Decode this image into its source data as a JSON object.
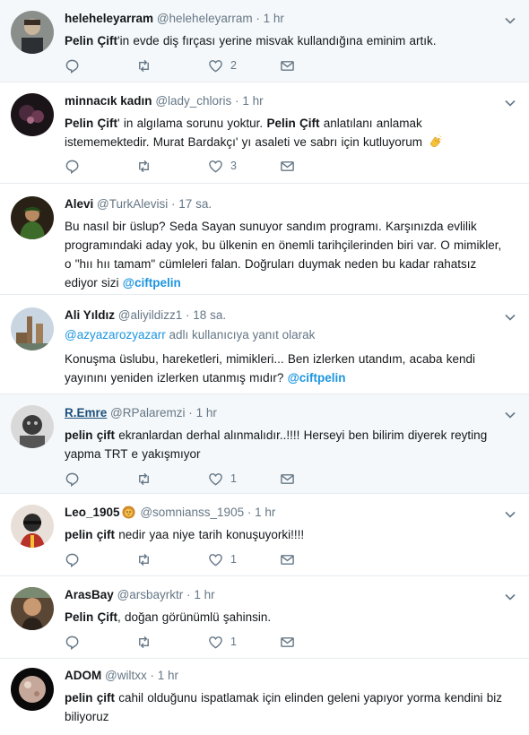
{
  "tweets": [
    {
      "name": "heleheleyarram",
      "handle": "@heleheleyarram",
      "time": "1 hr",
      "text_parts": [
        {
          "t": "Pelin Çift",
          "b": true
        },
        {
          "t": "'in evde diş fırçası yerine misvak kullandığına eminim artık."
        }
      ],
      "likes": "2"
    },
    {
      "name": "minnacık kadın",
      "handle": "@lady_chloris",
      "time": "1 hr",
      "text_parts": [
        {
          "t": "Pelin Çift",
          "b": true
        },
        {
          "t": "' in algılama sorunu yoktur. "
        },
        {
          "t": "Pelin Çift",
          "b": true
        },
        {
          "t": " anlatılanı anlamak istememektedir. Murat Bardakçı' yı asaleti ve sabrı için kutluyorum "
        }
      ],
      "likes": "3"
    },
    {
      "name": "Alevi",
      "handle": "@TurkAlevisi",
      "time": "17 sa.",
      "text_parts": [
        {
          "t": "Bu nasıl bir üslup? Seda Sayan sunuyor sandım programı. Karşınızda evlilik programındaki aday yok, bu ülkenin en önemli tarihçilerinden biri var. O mimikler, o \"hıı hıı tamam\" cümleleri falan. Doğruları duymak neden bu kadar rahatsız ediyor sizi "
        },
        {
          "t": "@ciftpelin",
          "m": true
        }
      ]
    },
    {
      "name": "Ali Yıldız",
      "handle": "@aliyildizz1",
      "time": "18 sa.",
      "reply_to": "@azyazarozyazarr",
      "reply_label": " adlı kullanıcıya yanıt olarak",
      "text_parts": [
        {
          "t": "Konuşma üslubu, hareketleri, mimikleri... Ben izlerken utandım, acaba kendi yayınını yeniden izlerken utanmış mıdır? "
        },
        {
          "t": "@ciftpelin",
          "m": true
        }
      ]
    },
    {
      "name": "R.Emre",
      "handle": "@RPalaremzi",
      "time": "1 hr",
      "text_parts": [
        {
          "t": "pelin çift",
          "b": true
        },
        {
          "t": " ekranlardan derhal alınmalıdır..!!!! Herseyi ben bilirim diyerek reyting yapma TRT e yakışmıyor"
        }
      ],
      "likes": "1"
    },
    {
      "name": "Leo_1905",
      "handle": "@somnianss_1905",
      "time": "1 hr",
      "text_parts": [
        {
          "t": "pelin çift",
          "b": true
        },
        {
          "t": " nedir yaa niye tarih konuşuyorki!!!!"
        }
      ],
      "likes": "1"
    },
    {
      "name": "ArasBay",
      "handle": "@arsbayrktr",
      "time": "1 hr",
      "text_parts": [
        {
          "t": "Pelin Çift",
          "b": true
        },
        {
          "t": ", doğan görünümlü şahinsin."
        }
      ],
      "likes": "1"
    },
    {
      "name": "ADOM",
      "handle": "@wiltxx",
      "time": "1 hr",
      "text_parts": [
        {
          "t": "pelin çift",
          "b": true
        },
        {
          "t": " cahil olduğunu ispatlamak için elinden geleni yapıyor yorma kendini biz biliyoruz"
        }
      ]
    }
  ],
  "separator": "·",
  "colors": {
    "link": "#1b95e0",
    "muted": "#657786",
    "highlight_bg": "#f5f8fa",
    "border": "#e6ecf0"
  },
  "icons": [
    "reply-icon",
    "retweet-icon",
    "like-icon",
    "direct-message-icon",
    "chevron-down-icon",
    "clapping-hands-emoji",
    "lion-emoji"
  ]
}
